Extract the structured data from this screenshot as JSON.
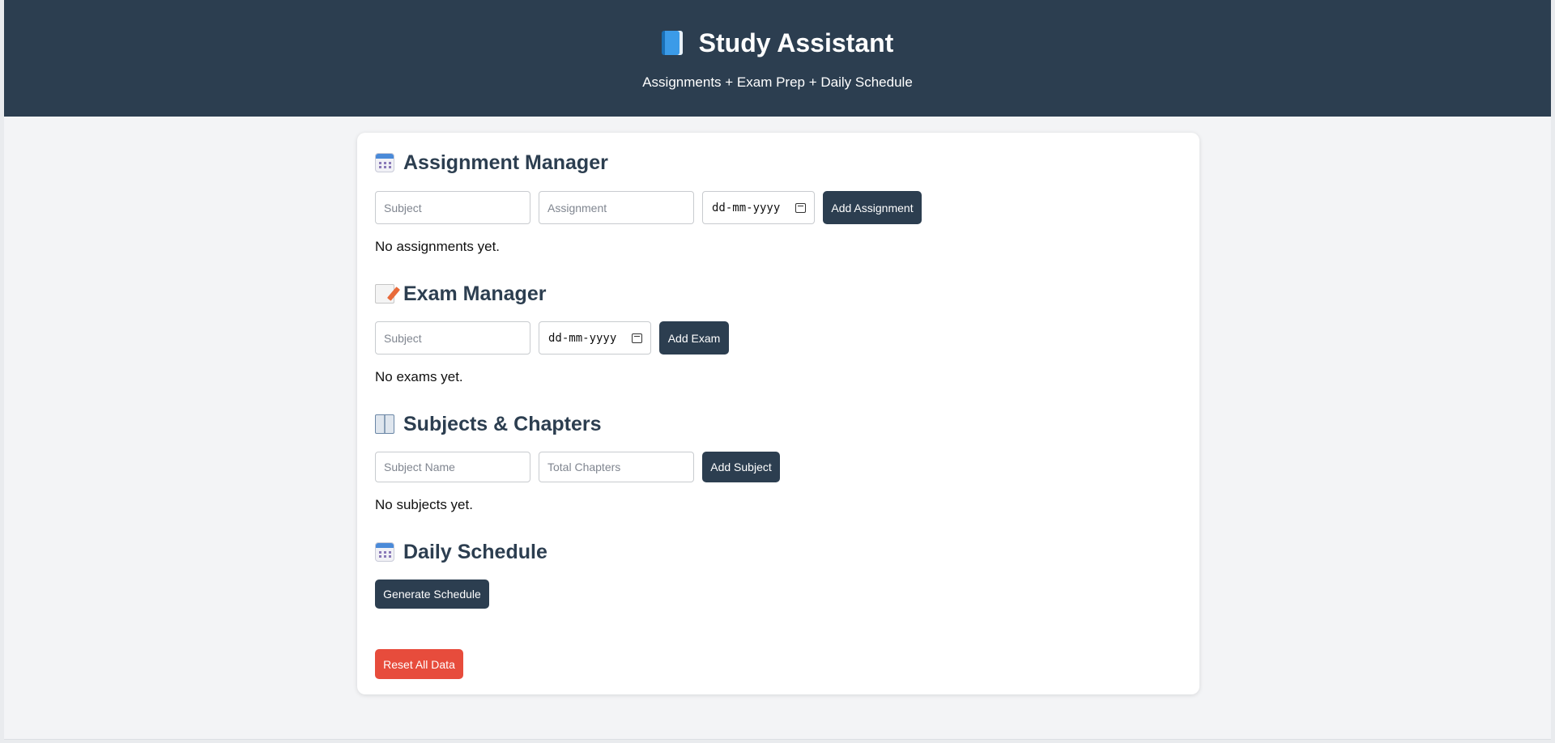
{
  "header": {
    "title": "Study Assistant",
    "subtitle": "Assignments + Exam Prep + Daily Schedule",
    "icon": "blue-book-icon"
  },
  "assignments": {
    "title": "Assignment Manager",
    "icon": "calendar-icon",
    "subject_placeholder": "Subject",
    "assignment_placeholder": "Assignment",
    "date_placeholder": "dd-mm-yyyy",
    "add_label": "Add Assignment",
    "empty_text": "No assignments yet."
  },
  "exams": {
    "title": "Exam Manager",
    "icon": "memo-icon",
    "subject_placeholder": "Subject",
    "date_placeholder": "dd-mm-yyyy",
    "add_label": "Add Exam",
    "empty_text": "No exams yet."
  },
  "subjects": {
    "title": "Subjects & Chapters",
    "icon": "open-book-icon",
    "name_placeholder": "Subject Name",
    "chapters_placeholder": "Total Chapters",
    "add_label": "Add Subject",
    "empty_text": "No subjects yet."
  },
  "schedule": {
    "title": "Daily Schedule",
    "icon": "calendar-icon",
    "generate_label": "Generate Schedule"
  },
  "reset": {
    "label": "Reset All Data"
  },
  "colors": {
    "header_bg": "#2c3e50",
    "primary_button": "#2c3e50",
    "danger_button": "#e74c3c",
    "page_bg": "#f3f4f6"
  }
}
